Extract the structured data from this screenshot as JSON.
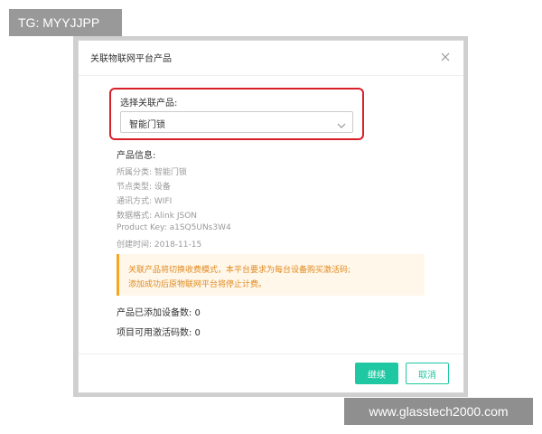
{
  "tg_tag": "TG: MYYJJPP",
  "watermark": "www.glasstech2000.com",
  "dialog": {
    "title": "关联物联网平台产品",
    "close_icon": "close-icon",
    "select": {
      "label": "选择关联产品:",
      "value": "智能门锁",
      "icon": "chevron-down-icon"
    },
    "info": {
      "title": "产品信息:",
      "rows": [
        "所属分类:  智能门锁",
        "节点类型:  设备",
        "通讯方式:  WIFI",
        "数据格式:  Alink JSON",
        "Product Key:  a1SQ5UNs3W4",
        "创建时间:  2018-11-15"
      ]
    },
    "notice": {
      "line1": "关联产品将切换收费模式，本平台要求为每台设备购买激活码;",
      "line2": "添加成功后原物联网平台将停止计费。"
    },
    "counts": {
      "added_devices": "产品已添加设备数:  0",
      "available_codes": "项目可用激活码数:  0"
    },
    "buttons": {
      "continue_label": "继续",
      "cancel_label": "取消"
    }
  },
  "colors": {
    "accent": "#1fc8a3",
    "highlight_border": "#d8202a",
    "notice_text": "#e08a1e",
    "notice_bar": "#f5a623"
  }
}
